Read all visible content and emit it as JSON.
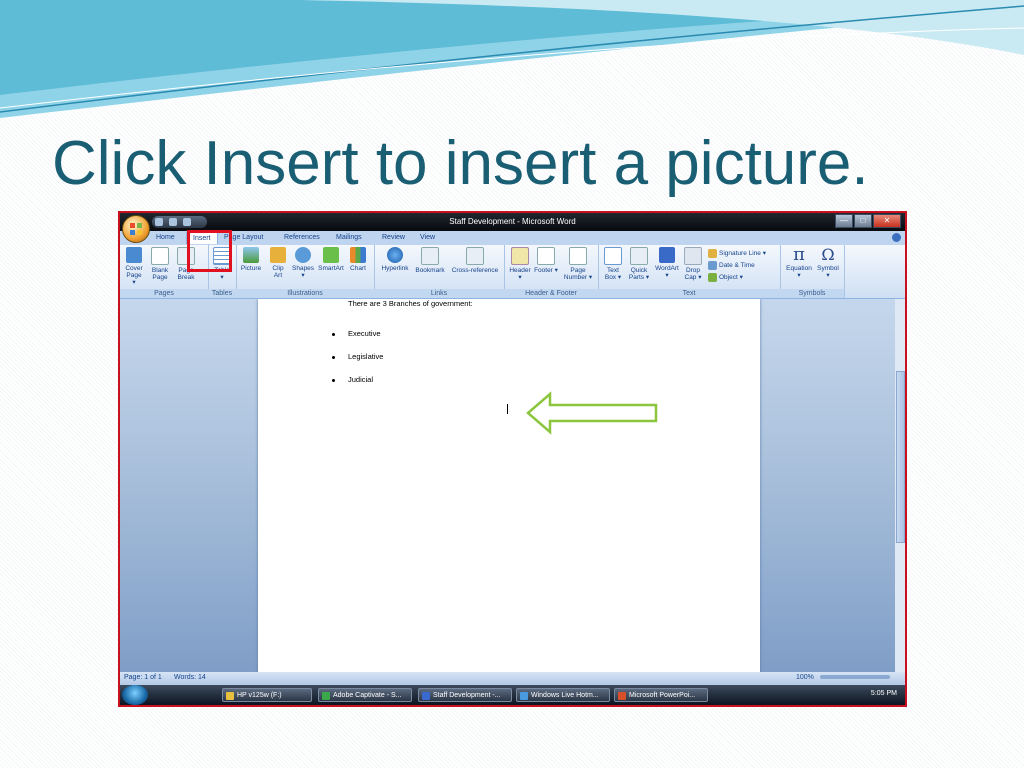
{
  "slide": {
    "title": "Click Insert to insert a picture."
  },
  "window": {
    "title": "Staff Development - Microsoft Word",
    "minimize": "—",
    "maximize": "□",
    "close": "✕"
  },
  "tabs": [
    "Home",
    "Insert",
    "Page Layout",
    "References",
    "Mailings",
    "Review",
    "View"
  ],
  "active_tab": "Insert",
  "ribbon": {
    "groups": {
      "pages": "Pages",
      "tables": "Tables",
      "illustrations": "Illustrations",
      "links": "Links",
      "header_footer": "Header & Footer",
      "text": "Text",
      "symbols": "Symbols"
    },
    "pages": {
      "cover": "Cover Page ▾",
      "blank": "Blank Page",
      "break": "Page Break"
    },
    "tables": {
      "table": "Table ▾"
    },
    "illustrations": {
      "picture": "Picture",
      "clipart": "Clip Art",
      "shapes": "Shapes ▾",
      "smartart": "SmartArt",
      "chart": "Chart"
    },
    "links": {
      "hyperlink": "Hyperlink",
      "bookmark": "Bookmark",
      "crossref": "Cross-reference"
    },
    "header_footer": {
      "header": "Header ▾",
      "footer": "Footer ▾",
      "pagenumber": "Page Number ▾"
    },
    "text": {
      "textbox": "Text Box ▾",
      "quickparts": "Quick Parts ▾",
      "wordart": "WordArt ▾",
      "dropcap": "Drop Cap ▾",
      "signature": "Signature Line ▾",
      "datetime": "Date & Time",
      "object": "Object ▾"
    },
    "symbols": {
      "equation": "Equation ▾",
      "symbol": "Symbol ▾"
    }
  },
  "document": {
    "intro": "There are 3 Branches of government:",
    "bullets": [
      "Executive",
      "Legislative",
      "Judicial"
    ]
  },
  "status": {
    "page": "Page: 1 of 1",
    "words": "Words: 14",
    "zoom": "100%"
  },
  "taskbar": {
    "items": [
      "HP v125w (F:)",
      "Adobe Captivate - S...",
      "Staff Development -...",
      "Windows Live Hotm...",
      "Microsoft PowerPoi..."
    ],
    "time": "5:05 PM"
  },
  "colors": {
    "title": "#1a5e74",
    "highlight": "#e0101e",
    "arrow": "#8cc63f"
  },
  "icons": [
    "office-button-icon",
    "quick-access-icon",
    "help-icon",
    "picture-icon",
    "table-icon",
    "green-arrow-icon"
  ]
}
